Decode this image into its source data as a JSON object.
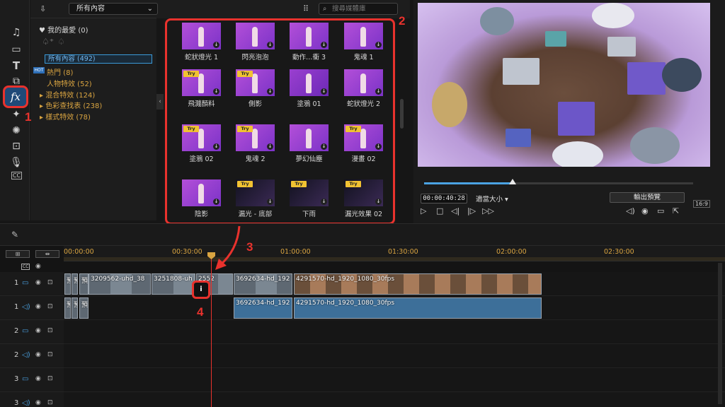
{
  "library": {
    "dropdown": "所有內容",
    "search_placeholder": "搜尋媒體庫",
    "favorites": "我的最愛 (0)",
    "categories": [
      {
        "label": "所有內容 (492)",
        "selected": true
      },
      {
        "label": "熱門 (8)",
        "badge": "HOT"
      },
      {
        "label": "人物特效 (52)"
      },
      {
        "label": "混合特效 (124)",
        "expandable": true
      },
      {
        "label": "色彩查找表 (238)",
        "expandable": true
      },
      {
        "label": "樣式特效 (78)",
        "expandable": true
      }
    ],
    "tiles": [
      {
        "label": "蛇狀燈光 1",
        "try": false,
        "style": "purple"
      },
      {
        "label": "閃亮泡泡",
        "try": false,
        "style": "purple"
      },
      {
        "label": "動作…衝 3",
        "try": false,
        "style": "purple"
      },
      {
        "label": "鬼魂 1",
        "try": false,
        "style": "purple"
      },
      {
        "label": "飛濺顏料",
        "try": true,
        "style": "purple"
      },
      {
        "label": "側影",
        "try": true,
        "style": "purple"
      },
      {
        "label": "塗鴉 01",
        "try": false,
        "style": "doodle"
      },
      {
        "label": "蛇狀燈光 2",
        "try": false,
        "style": "purple"
      },
      {
        "label": "塗鴉 02",
        "try": true,
        "style": "purple"
      },
      {
        "label": "鬼魂 2",
        "try": true,
        "style": "purple"
      },
      {
        "label": "夢幻仙塵",
        "try": false,
        "style": "purple"
      },
      {
        "label": "漫畫 02",
        "try": true,
        "style": "purple"
      },
      {
        "label": "陰影",
        "try": false,
        "style": "purple"
      },
      {
        "label": "漏光 - 底部",
        "try": true,
        "style": "dark"
      },
      {
        "label": "下雨",
        "try": true,
        "style": "dark"
      },
      {
        "label": "漏光效果 02",
        "try": true,
        "style": "dark"
      }
    ],
    "try_badge": "Try"
  },
  "preview": {
    "timecode": "00:00:40:28",
    "fit_label": "適當大小",
    "export_preview": "輸出預覽",
    "ratio": "16:9",
    "progress": 0.33
  },
  "annotations": {
    "a1": "1",
    "a2": "2",
    "a3": "3",
    "a4": "4"
  },
  "timeline": {
    "ruler": [
      "00:00:00",
      "00:30:00",
      "01:00:00",
      "01:30:00",
      "02:00:00",
      "02:30:00"
    ],
    "tracks": [
      {
        "num": "1",
        "type": "video"
      },
      {
        "num": "1",
        "type": "audio"
      },
      {
        "num": "2",
        "type": "video"
      },
      {
        "num": "2",
        "type": "audio"
      },
      {
        "num": "3",
        "type": "video"
      },
      {
        "num": "3",
        "type": "audio"
      }
    ],
    "video_clips": [
      {
        "label": "預"
      },
      {
        "label": "預"
      },
      {
        "label": "預"
      },
      {
        "label": "3209562-uhd_38"
      },
      {
        "label": "3251808-uh"
      },
      {
        "label": "2552"
      },
      {
        "label": "3692634-hd_192"
      },
      {
        "label": "4291570-hd_1920_1080_30fps"
      }
    ],
    "audio_clips": [
      {
        "label": "預"
      },
      {
        "label": "預"
      },
      {
        "label": "預"
      },
      {
        "label": "3692634-hd_192"
      },
      {
        "label": "4291570-hd_1920_1080_30fps"
      }
    ],
    "fx_marker": "i"
  },
  "colors": {
    "accent": "#e8322d",
    "blue": "#4ba3e3",
    "gold": "#d9a441"
  }
}
